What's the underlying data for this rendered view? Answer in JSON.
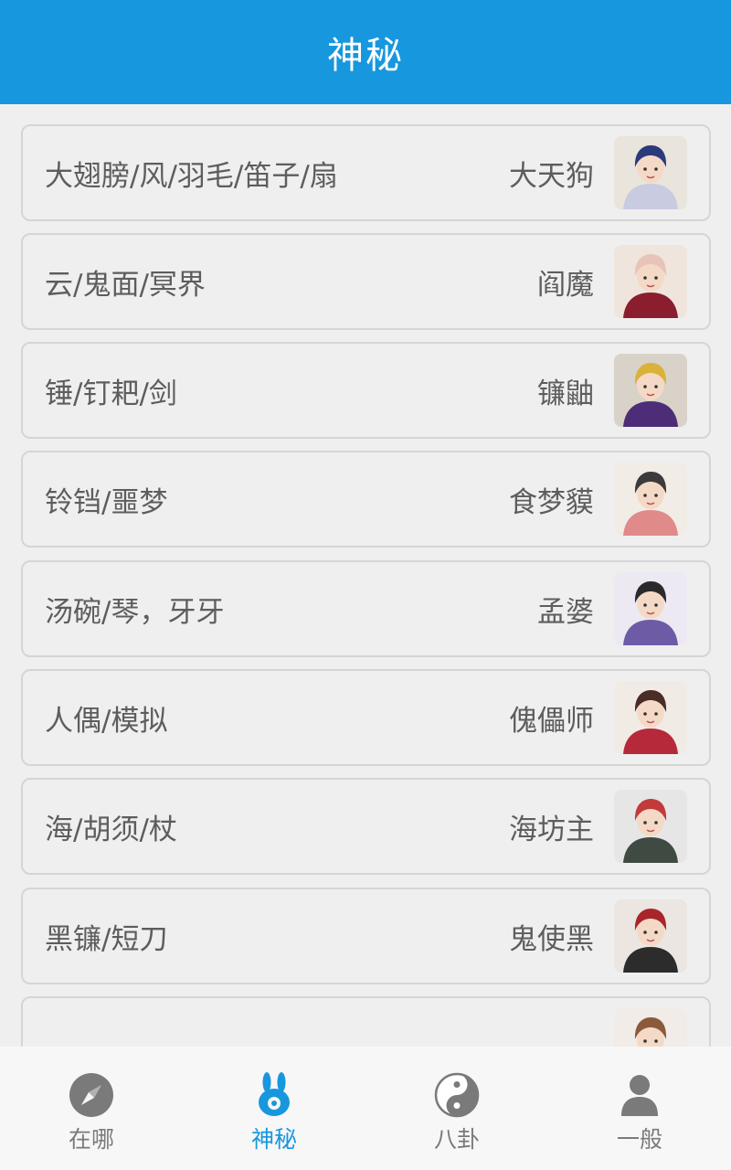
{
  "header": {
    "title": "神秘"
  },
  "list": [
    {
      "clues": "大翅膀/风/羽毛/笛子/扇",
      "name": "大天狗",
      "avatar_palette": [
        "#e9e4dc",
        "#c9cbe0",
        "#2a3a7a"
      ]
    },
    {
      "clues": "云/鬼面/冥界",
      "name": "阎魔",
      "avatar_palette": [
        "#efe5dc",
        "#8a1e2e",
        "#e7c3b9"
      ]
    },
    {
      "clues": "锤/钉耙/剑",
      "name": "镰鼬",
      "avatar_palette": [
        "#d8d2c8",
        "#4d2d78",
        "#d9b23a"
      ]
    },
    {
      "clues": "铃铛/噩梦",
      "name": "食梦貘",
      "avatar_palette": [
        "#f2ece6",
        "#e08a8a",
        "#3b3b3b"
      ]
    },
    {
      "clues": "汤碗/琴，牙牙",
      "name": "孟婆",
      "avatar_palette": [
        "#ece9f2",
        "#6e5ba6",
        "#2a2a2a"
      ]
    },
    {
      "clues": "人偶/模拟",
      "name": "傀儡师",
      "avatar_palette": [
        "#f1ebe6",
        "#b6293a",
        "#4a2c28"
      ]
    },
    {
      "clues": "海/胡须/杖",
      "name": "海坊主",
      "avatar_palette": [
        "#e6e6e6",
        "#3f4a43",
        "#c23a3a"
      ]
    },
    {
      "clues": "黑镰/短刀",
      "name": "鬼使黑",
      "avatar_palette": [
        "#ebe6e1",
        "#2c2c2c",
        "#a8262a"
      ]
    },
    {
      "clues": "",
      "name": "",
      "avatar_palette": [
        "#f1ece8",
        "#d04a3a",
        "#8a5a3a"
      ]
    }
  ],
  "tabbar": {
    "tabs": [
      {
        "label": "在哪",
        "icon": "compass-icon",
        "active": false
      },
      {
        "label": "神秘",
        "icon": "rabbit-icon",
        "active": true
      },
      {
        "label": "八卦",
        "icon": "yin-yang-icon",
        "active": false
      },
      {
        "label": "一般",
        "icon": "person-icon",
        "active": false
      }
    ]
  },
  "colors": {
    "accent": "#1797dd",
    "text": "#5d5d5d",
    "tab_inactive": "#7a7a7a",
    "background": "#efeff0"
  }
}
